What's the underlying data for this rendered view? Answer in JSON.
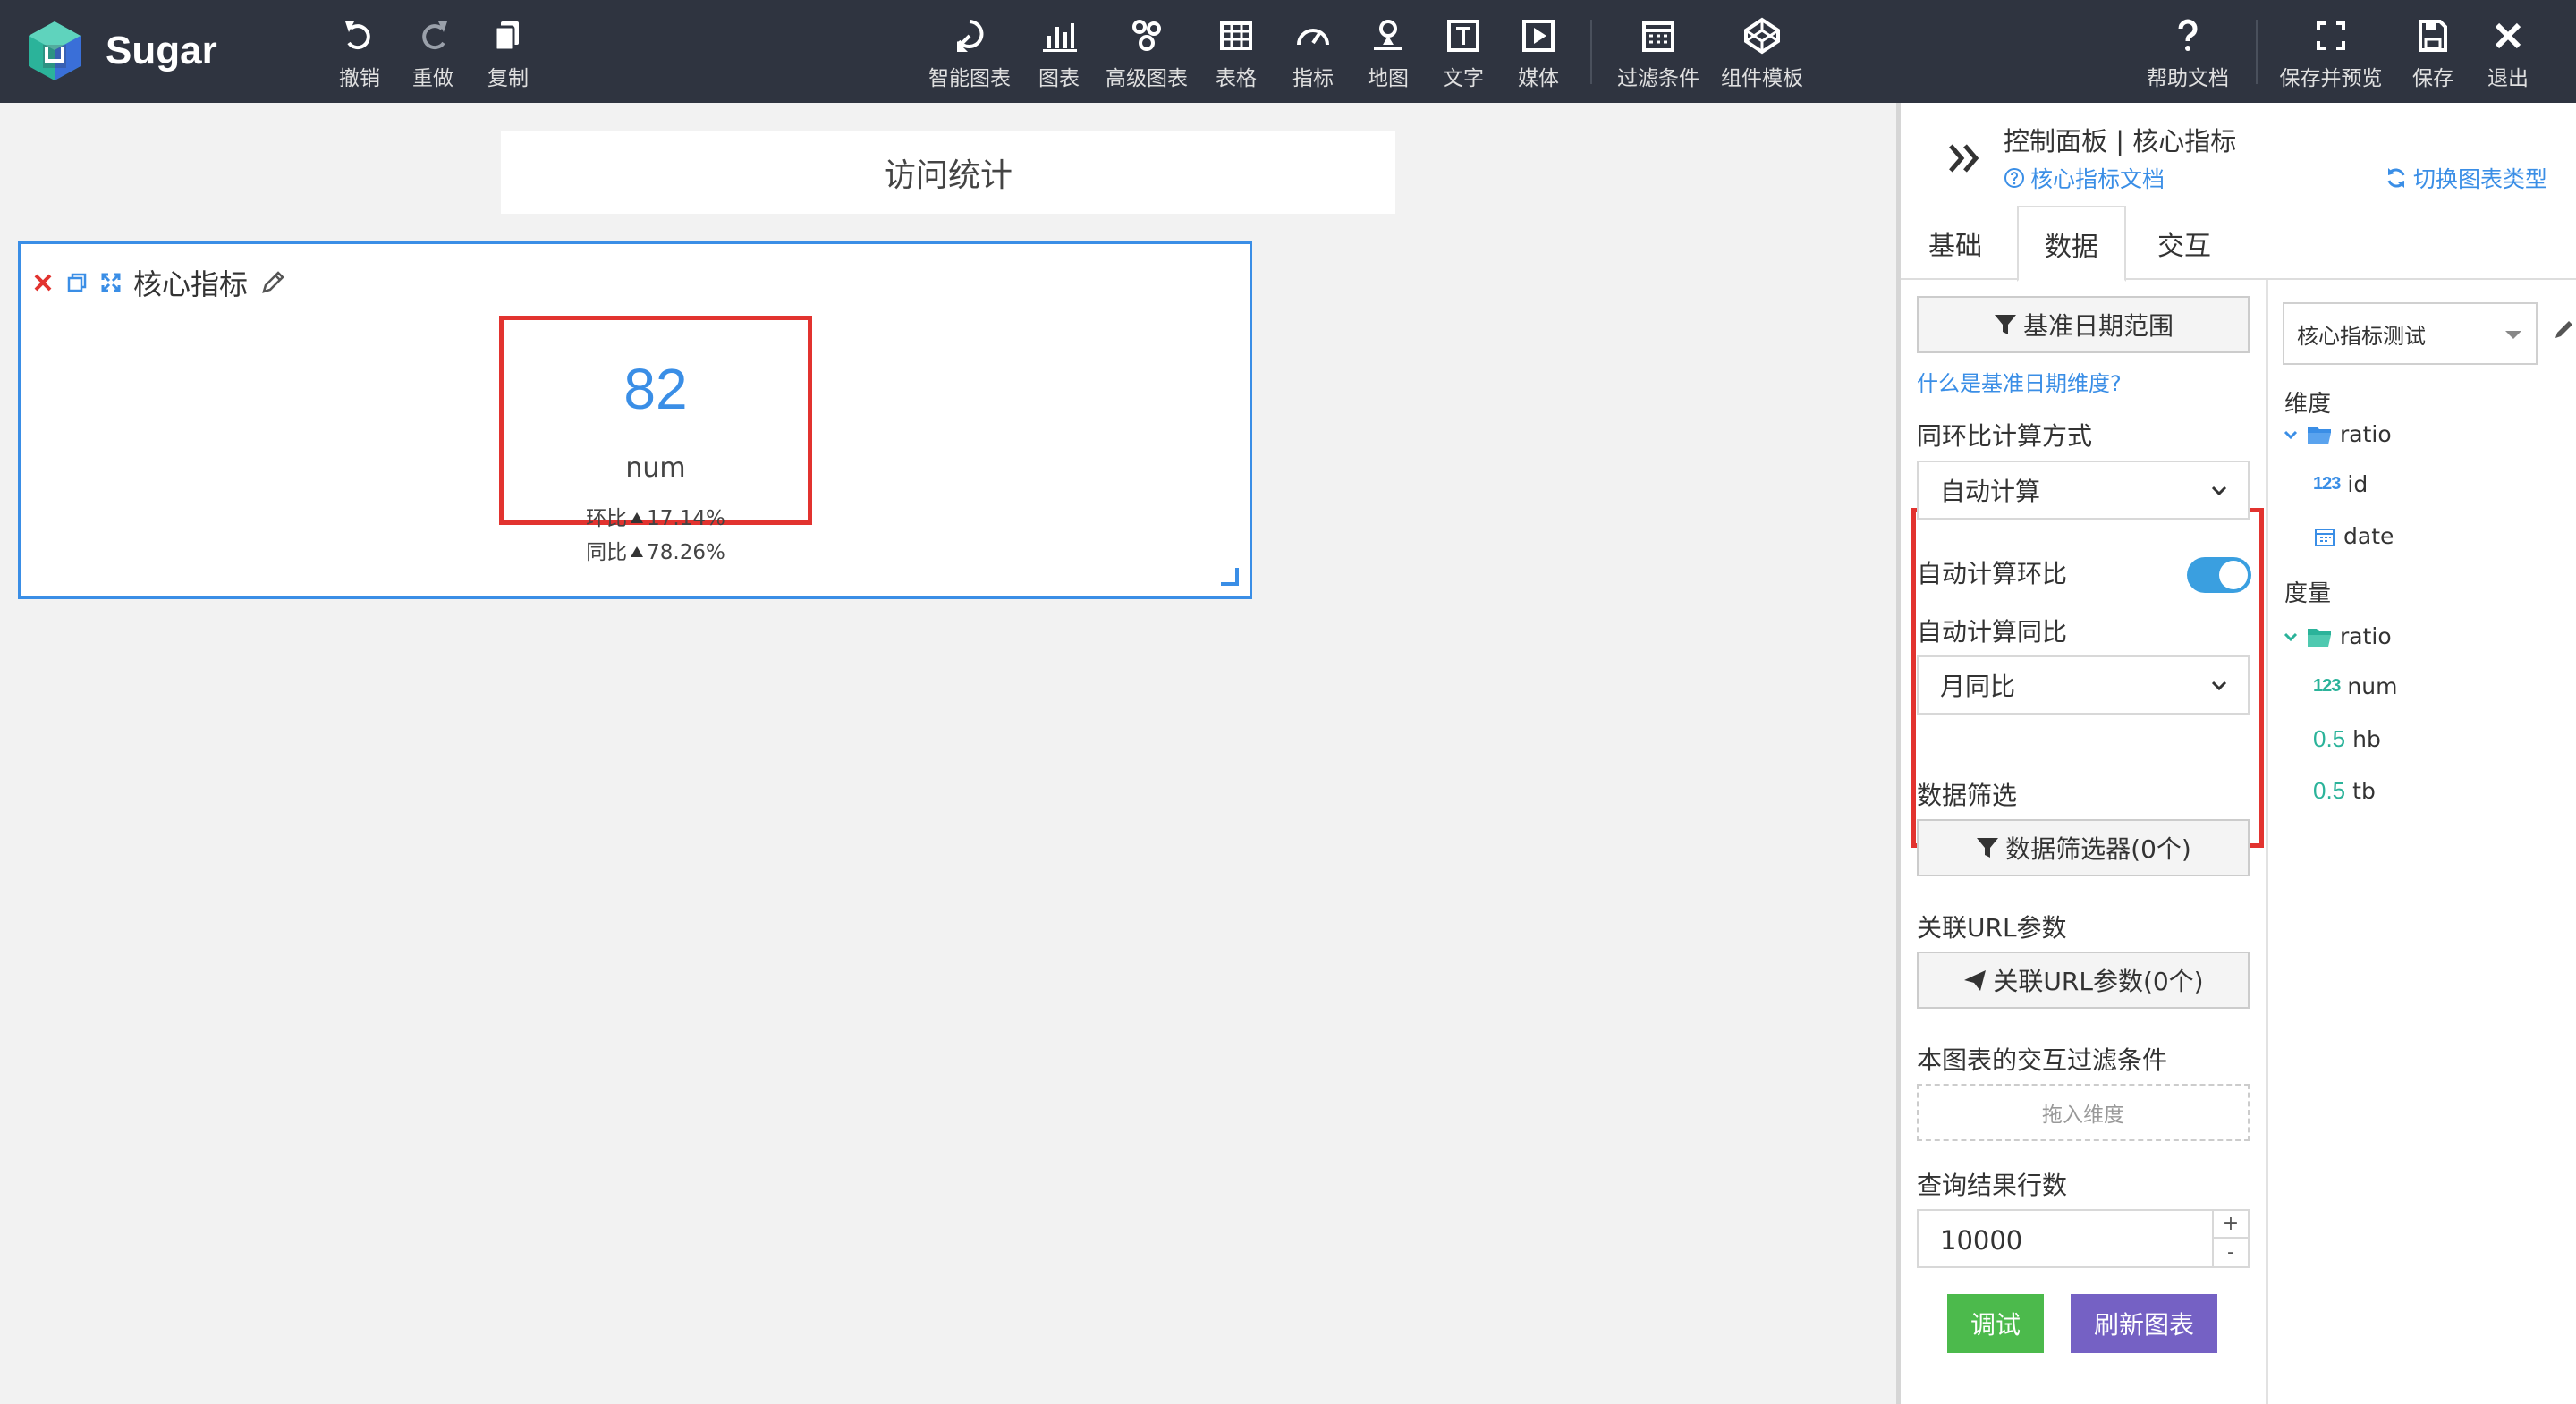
{
  "app": {
    "brand": "Sugar",
    "colors": {
      "accent": "#3a8ee6",
      "topbar": "#2f3440",
      "highlight": "#e2332f",
      "green": "#4cba4c",
      "purple": "#7561c4"
    }
  },
  "toolbar": {
    "undo": "撤销",
    "redo": "重做",
    "copy": "复制",
    "smart_chart": "智能图表",
    "chart": "图表",
    "advanced_chart": "高级图表",
    "table": "表格",
    "metric": "指标",
    "map": "地图",
    "text": "文字",
    "media": "媒体",
    "filter": "过滤条件",
    "template": "组件模板",
    "help": "帮助文档",
    "save_preview": "保存并预览",
    "save": "保存",
    "exit": "退出"
  },
  "canvas": {
    "page_title": "访问统计",
    "widget": {
      "title": "核心指标",
      "value": "82",
      "name": "num",
      "hb_label": "环比",
      "hb_value": "17.14%",
      "tb_label": "同比",
      "tb_value": "78.26%"
    }
  },
  "panel": {
    "title": "控制面板 | 核心指标",
    "doc_link": "核心指标文档",
    "switch_type": "切换图表类型",
    "tabs": [
      "基础",
      "数据",
      "交互"
    ],
    "active_tab": "数据",
    "base_date_btn": "基准日期范围",
    "base_date_help": "什么是基准日期维度?",
    "calc_method_label": "同环比计算方式",
    "calc_method_value": "自动计算",
    "auto_hb_label": "自动计算环比",
    "auto_hb_on": true,
    "auto_tb_label": "自动计算同比",
    "auto_tb_value": "月同比",
    "data_filter_label": "数据筛选",
    "data_filter_btn": "数据筛选器(0个)",
    "url_param_label": "关联URL参数",
    "url_param_btn": "关联URL参数(0个)",
    "interaction_filter_label": "本图表的交互过滤条件",
    "dropzone": "拖入维度",
    "rows_label": "查询结果行数",
    "rows_value": "10000",
    "spin_plus": "+",
    "spin_minus": "-",
    "debug_btn": "调试",
    "refresh_btn": "刷新图表",
    "dataset": "核心指标测试",
    "dimension_label": "维度",
    "measure_label": "度量",
    "dimensions": {
      "folder": "ratio",
      "fields": [
        {
          "type": "123",
          "name": "id"
        },
        {
          "type": "date",
          "name": "date"
        }
      ]
    },
    "measures": {
      "folder": "ratio",
      "fields": [
        {
          "type": "123",
          "name": "num"
        },
        {
          "type": "0.5",
          "name": "hb"
        },
        {
          "type": "0.5",
          "name": "tb"
        }
      ]
    }
  }
}
